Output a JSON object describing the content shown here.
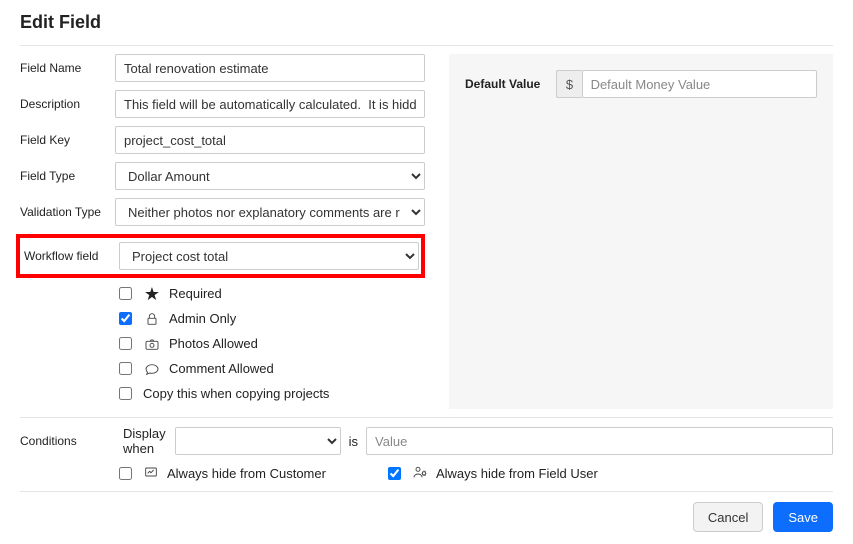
{
  "title": "Edit Field",
  "labels": {
    "field_name": "Field Name",
    "description": "Description",
    "field_key": "Field Key",
    "field_type": "Field Type",
    "validation_type": "Validation Type",
    "workflow_field": "Workflow field",
    "default_value": "Default Value",
    "conditions": "Conditions",
    "display_when": "Display when",
    "is": "is"
  },
  "values": {
    "field_name": "Total renovation estimate",
    "description": "This field will be automatically calculated.  It is hidden from customer and field user.",
    "field_key": "project_cost_total",
    "field_type": "Dollar Amount",
    "validation_type": "Neither photos nor explanatory comments are required",
    "workflow_field": "Project cost total",
    "default_value": "",
    "default_placeholder": "Default Money Value",
    "money_symbol": "$",
    "cond_value_placeholder": "Value"
  },
  "checks": {
    "required": {
      "label": "Required",
      "checked": false
    },
    "admin_only": {
      "label": "Admin Only",
      "checked": true
    },
    "photos_allowed": {
      "label": "Photos Allowed",
      "checked": false
    },
    "comment_allowed": {
      "label": "Comment Allowed",
      "checked": false
    },
    "copy_project": {
      "label": "Copy this when copying projects",
      "checked": false
    },
    "hide_customer": {
      "label": "Always hide from Customer",
      "checked": false
    },
    "hide_field_user": {
      "label": "Always hide from Field User",
      "checked": true
    }
  },
  "buttons": {
    "cancel": "Cancel",
    "save": "Save"
  }
}
